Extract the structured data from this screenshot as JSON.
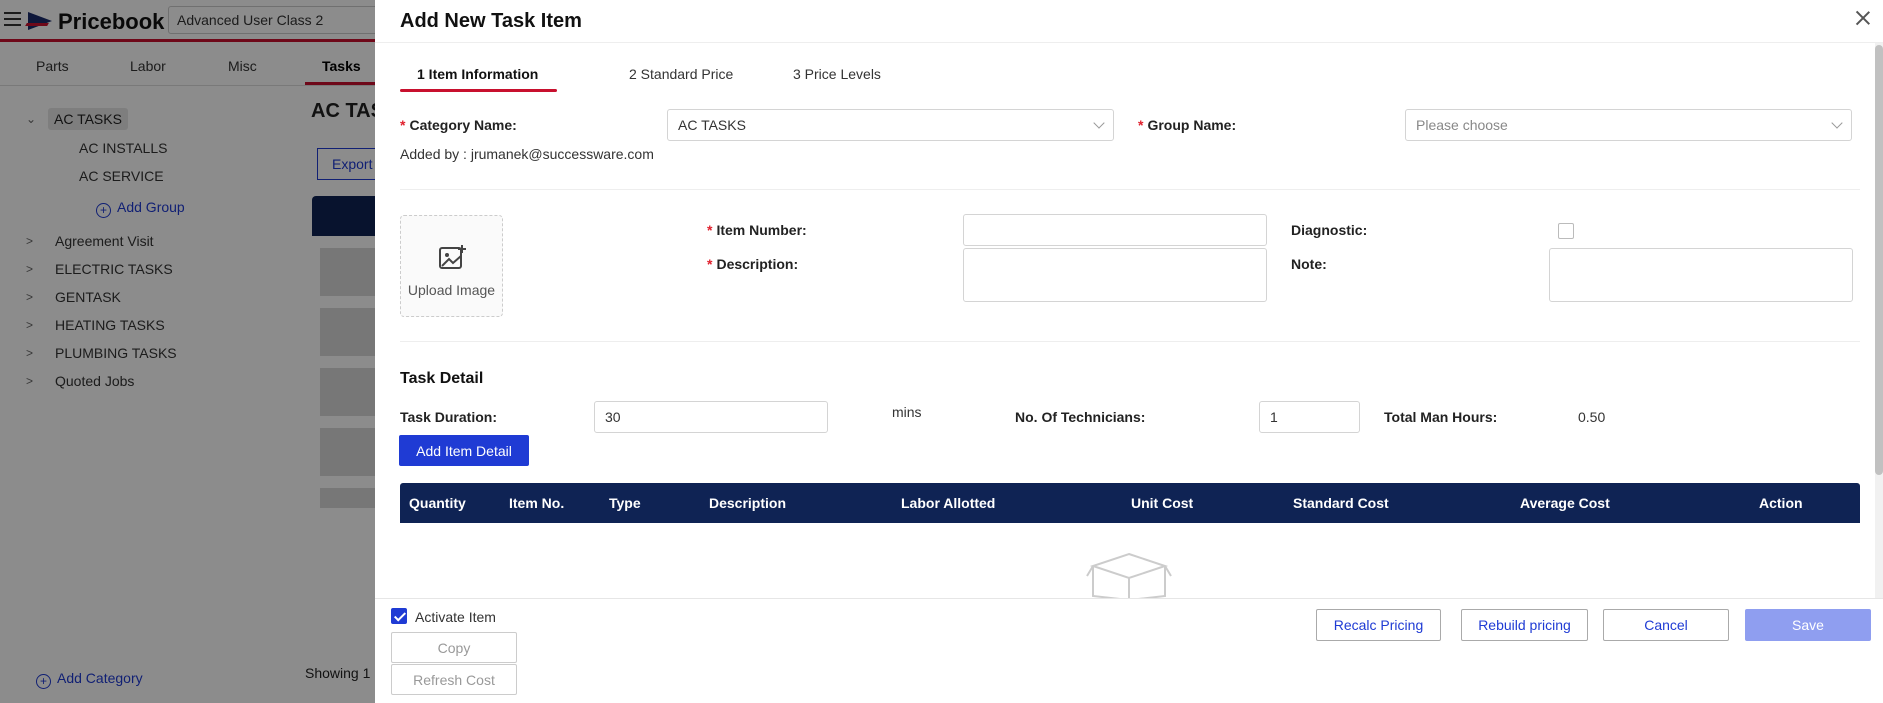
{
  "background": {
    "app_title": "Pricebook",
    "company": "Advanced User Class 2",
    "nav_tabs": [
      "Parts",
      "Labor",
      "Misc",
      "Tasks"
    ],
    "tree": {
      "selected": "AC TASKS",
      "children": [
        "AC INSTALLS",
        "AC SERVICE"
      ],
      "add_group": "Add Group",
      "categories": [
        "Agreement Visit",
        "ELECTRIC TASKS",
        "GENTASK",
        "HEATING TASKS",
        "PLUMBING TASKS",
        "Quoted Jobs"
      ],
      "add_category": "Add Category"
    },
    "page_title": "AC TAS",
    "export_label": "Export",
    "showing": "Showing 1"
  },
  "drawer": {
    "title": "Add New Task Item",
    "steps": [
      "1 Item Information",
      "2 Standard Price",
      "3 Price Levels"
    ],
    "category_label": "Category Name:",
    "category_value": "AC TASKS",
    "group_label": "Group Name:",
    "group_placeholder": "Please choose",
    "added_by": "Added by : jrumanek@successware.com",
    "upload_label": "Upload Image",
    "item_number_label": "Item Number:",
    "item_number_value": "",
    "description_label": "Description:",
    "description_value": "",
    "diagnostic_label": "Diagnostic:",
    "note_label": "Note:",
    "note_value": "",
    "task_detail_title": "Task Detail",
    "task_duration_label": "Task Duration:",
    "task_duration_value": "30",
    "mins_label": "mins",
    "technicians_label": "No. Of Technicians:",
    "technicians_value": "1",
    "man_hours_label": "Total Man Hours:",
    "man_hours_value": "0.50",
    "add_item_detail": "Add Item Detail",
    "grid_columns": [
      "Quantity",
      "Item No.",
      "Type",
      "Description",
      "Labor Allotted",
      "Unit Cost",
      "Standard Cost",
      "Average Cost",
      "Action"
    ]
  },
  "footer": {
    "activate_label": "Activate Item",
    "copy_label": "Copy",
    "refresh_label": "Refresh Cost",
    "recalc_label": "Recalc Pricing",
    "rebuild_label": "Rebuild pricing",
    "cancel_label": "Cancel",
    "save_label": "Save"
  },
  "colors": {
    "primary": "#1f3bd4",
    "header_navy": "#0f2354",
    "accent_red": "#c8102e"
  }
}
